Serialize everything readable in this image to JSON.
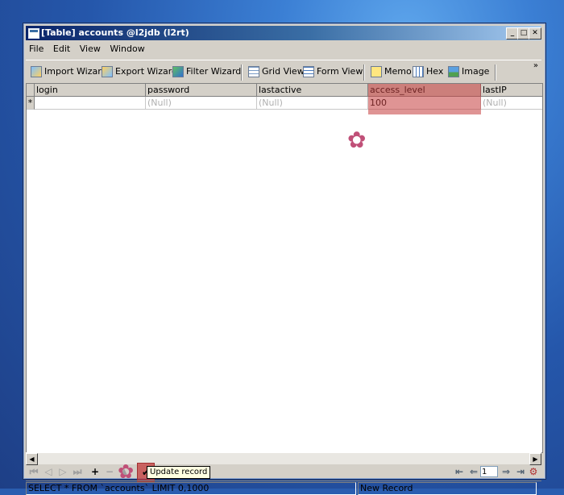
{
  "window": {
    "title": "[Table] accounts @l2jdb (l2rt)",
    "controls": {
      "minimize": "_",
      "maximize": "□",
      "close": "✕"
    }
  },
  "menu": {
    "items": [
      "File",
      "Edit",
      "View",
      "Window"
    ]
  },
  "toolbar": {
    "import_wizard": "Import Wizard",
    "export_wizard": "Export Wizard",
    "filter_wizard": "Filter Wizard",
    "grid_view": "Grid View",
    "form_view": "Form View",
    "memo": "Memo",
    "hex": "Hex",
    "image": "Image",
    "more": "»"
  },
  "grid": {
    "columns": [
      "login",
      "password",
      "lastactive",
      "access_level",
      "lastIP"
    ],
    "row_marker": "*",
    "rows": [
      {
        "login": "",
        "password": "(Null)",
        "lastactive": "(Null)",
        "access_level": "100",
        "lastIP": "(Null)"
      }
    ],
    "highlight_column": "access_level"
  },
  "navigator": {
    "page_value": "1"
  },
  "status": {
    "sql": "SELECT * FROM `accounts` LIMIT 0,1000",
    "mode": "New Record"
  },
  "tooltip": {
    "text": "Update record"
  },
  "colors": {
    "highlight": "#c43c3c",
    "title_start": "#0a246a",
    "title_end": "#a6caf0",
    "accent_flower": "#c05078"
  }
}
